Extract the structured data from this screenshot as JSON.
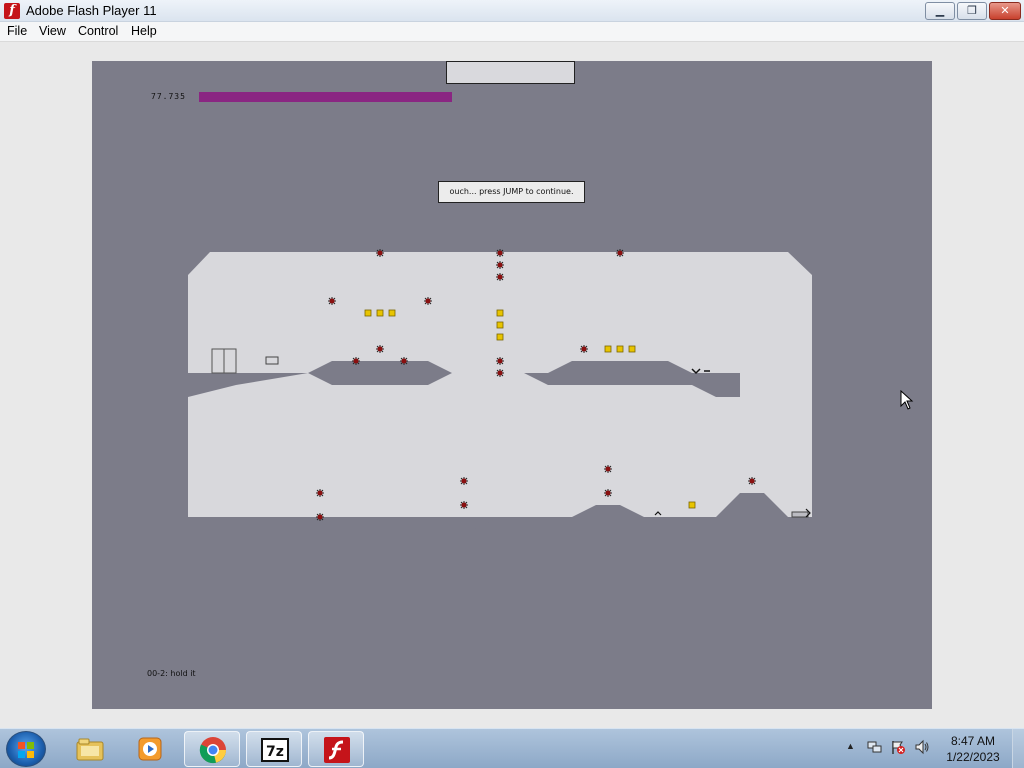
{
  "window": {
    "title": "Adobe Flash Player 11",
    "icon": "flash-player-icon",
    "controls": {
      "minimize": "minimize-icon",
      "maximize": "restore-icon",
      "close": "close-icon"
    }
  },
  "menu": {
    "file": "File",
    "view": "View",
    "control": "Control",
    "help": "Help"
  },
  "game": {
    "score": "77.735",
    "time_remaining_fraction": 0.95,
    "message": "ouch... press JUMP to continue.",
    "level_label": "00-2: hold it",
    "colors": {
      "background": "#7c7c89",
      "level_floor": "#d8d8dc",
      "platform": "#7c7c89",
      "time_bar": "#8a2682",
      "gold": "#e8c400",
      "mine": "#8a1010"
    },
    "objects": {
      "door": "exit-door",
      "switch": "exit-switch",
      "gold": "gold-pieces",
      "mines": "mines",
      "ninja": "ninja-player"
    }
  },
  "taskbar": {
    "start": "windows-start-icon",
    "buttons": [
      {
        "name": "explorer-icon"
      },
      {
        "name": "media-player-icon"
      },
      {
        "name": "chrome-icon"
      },
      {
        "name": "7zip-icon"
      },
      {
        "name": "flash-player-icon"
      }
    ],
    "tray": {
      "show_hidden": "▲",
      "network": "network-icon",
      "action_center": "action-center-flag-icon",
      "volume": "volume-icon"
    },
    "clock": {
      "time": "8:47 AM",
      "date": "1/22/2023"
    }
  }
}
